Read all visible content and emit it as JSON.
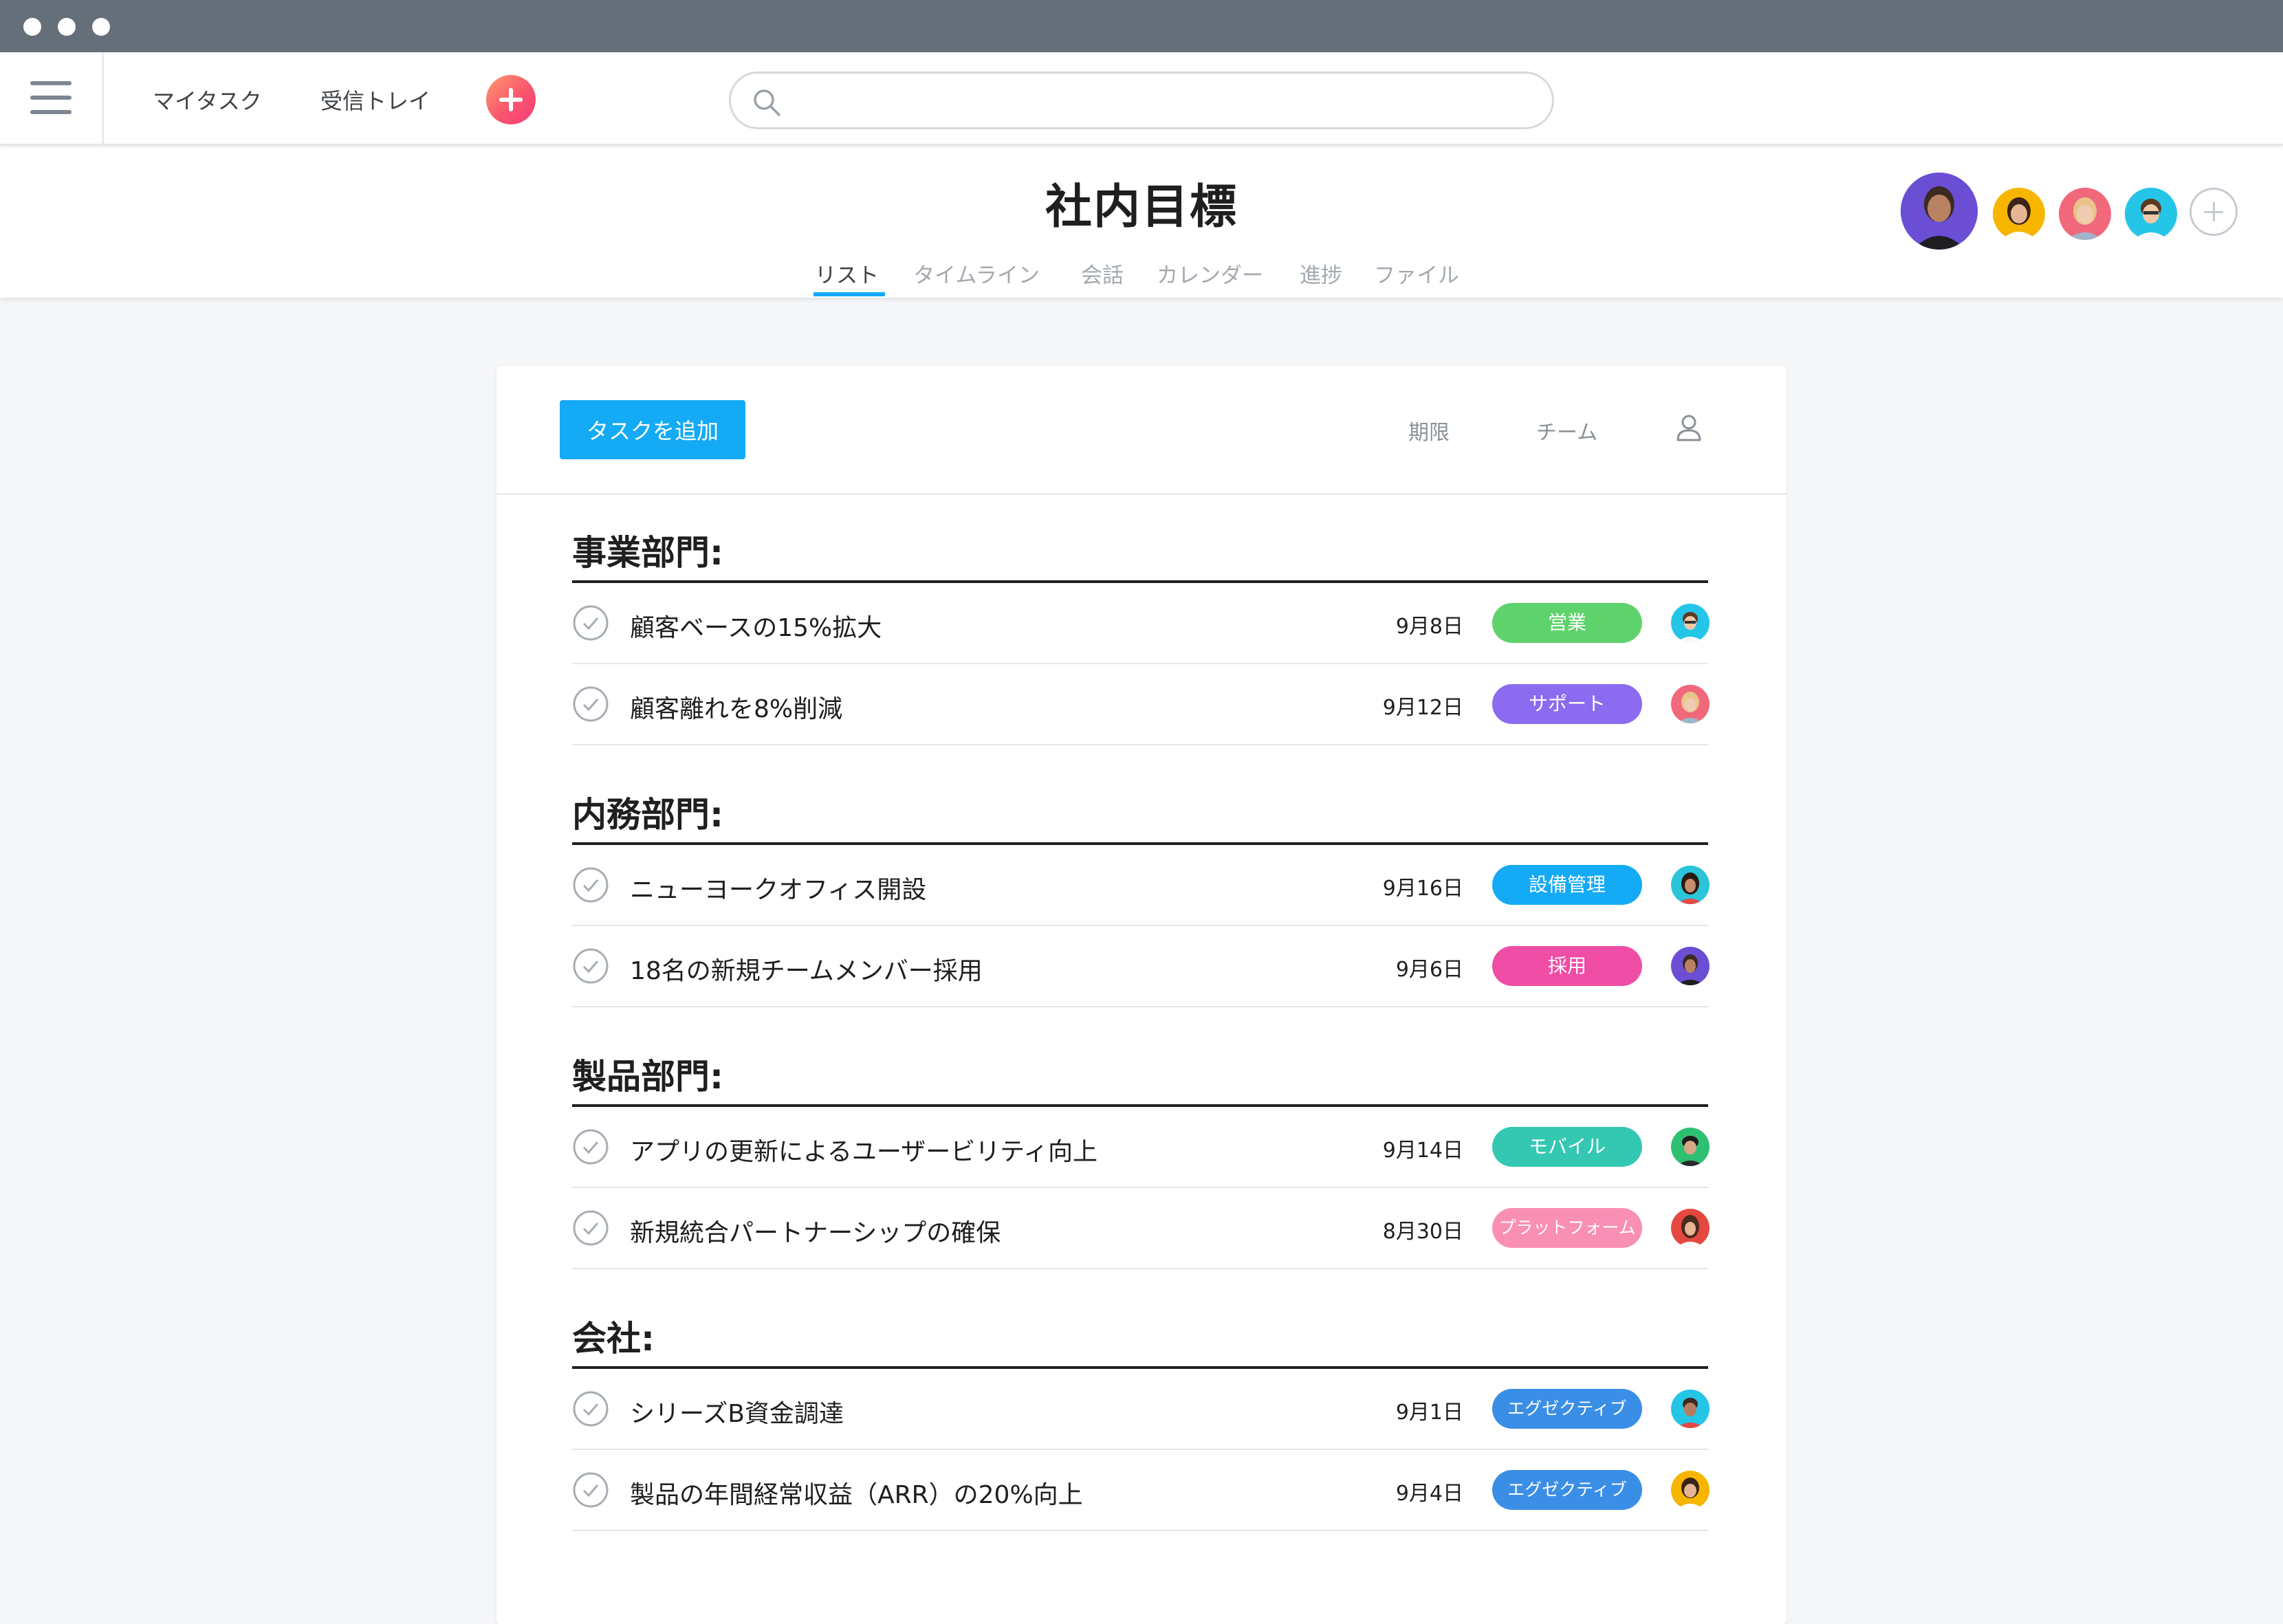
{
  "nav": {
    "my_tasks": "マイタスク",
    "inbox": "受信トレイ",
    "search_placeholder": "",
    "search_value": ""
  },
  "project": {
    "title": "社内目標",
    "tabs": [
      {
        "label": "リスト",
        "active": true
      },
      {
        "label": "タイムライン",
        "active": false
      },
      {
        "label": "会話",
        "active": false
      },
      {
        "label": "カレンダー",
        "active": false
      },
      {
        "label": "進捗",
        "active": false
      },
      {
        "label": "ファイル",
        "active": false
      }
    ]
  },
  "toolbar": {
    "add_task": "タスクを追加",
    "col_due": "期限",
    "col_team": "チーム"
  },
  "colors": {
    "accent": "#14aaf5",
    "tag_sales": "#5fd36b",
    "tag_support": "#8b6bf0",
    "tag_facilities": "#14aaf5",
    "tag_recruiting": "#ef4da6",
    "tag_mobile": "#34c7b2",
    "tag_platform": "#f98fb4",
    "tag_executive": "#3b8ee6"
  },
  "sections": [
    {
      "title": "事業部門:",
      "tasks": [
        {
          "name": "顧客ベースの15%拡大",
          "due": "9月8日",
          "tag": "営業",
          "tag_color": "#5fd36b"
        },
        {
          "name": "顧客離れを8%削減",
          "due": "9月12日",
          "tag": "サポート",
          "tag_color": "#8b6bf0"
        }
      ]
    },
    {
      "title": "内務部門:",
      "tasks": [
        {
          "name": "ニューヨークオフィス開設",
          "due": "9月16日",
          "tag": "設備管理",
          "tag_color": "#14aaf5"
        },
        {
          "name": "18名の新規チームメンバー採用",
          "due": "9月6日",
          "tag": "採用",
          "tag_color": "#ef4da6"
        }
      ]
    },
    {
      "title": "製品部門:",
      "tasks": [
        {
          "name": "アプリの更新によるユーザービリティ向上",
          "due": "9月14日",
          "tag": "モバイル",
          "tag_color": "#34c7b2"
        },
        {
          "name": "新規統合パートナーシップの確保",
          "due": "8月30日",
          "tag": "プラットフォーム",
          "tag_color": "#f98fb4"
        }
      ]
    },
    {
      "title": "会社:",
      "tasks": [
        {
          "name": "シリーズB資金調達",
          "due": "9月1日",
          "tag": "エグゼクティブ",
          "tag_color": "#3b8ee6"
        },
        {
          "name": "製品の年間経常収益（ARR）の20%向上",
          "due": "9月4日",
          "tag": "エグゼクティブ",
          "tag_color": "#3b8ee6"
        }
      ]
    }
  ]
}
